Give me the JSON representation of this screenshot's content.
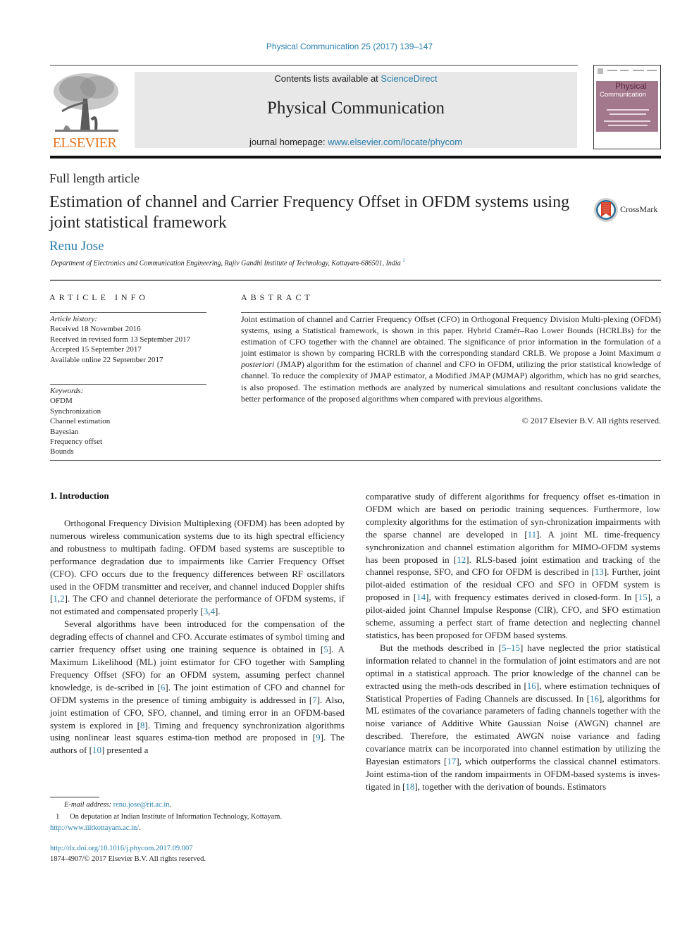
{
  "journal_reference": "Physical Communication 25 (2017) 139–147",
  "masthead": {
    "contents_prefix": "Contents lists available at ",
    "contents_link": "ScienceDirect",
    "journal_title": "Physical Communication",
    "homepage_prefix": "journal homepage: ",
    "homepage_link": "www.elsevier.com/locate/phycom",
    "publisher_logo_text": "ELSEVIER",
    "cover": {
      "title_line1": "Physical",
      "title_line2": "Communication"
    }
  },
  "colors": {
    "link": "#2a7fab",
    "elsevier_orange": "#e87722",
    "masthead_bg": "#e8e8e8",
    "cover_band": "#a4788c"
  },
  "article": {
    "type": "Full length article",
    "title": "Estimation of channel and Carrier Frequency Offset in OFDM systems using joint statistical framework",
    "crossmark_label": "CrossMark",
    "author": "Renu Jose",
    "affiliation": "Department of Electronics and Communication Engineering, Rajiv Gandhi Institute of Technology, Kottayam-686501, India",
    "affiliation_footnote_mark": "1"
  },
  "article_info": {
    "heading": "ARTICLE INFO",
    "history_label": "Article history:",
    "history": [
      "Received 18 November 2016",
      "Received in revised form 13 September 2017",
      "Accepted 15 September 2017",
      "Available online 22 September 2017"
    ],
    "keywords_label": "Keywords:",
    "keywords": [
      "OFDM",
      "Synchronization",
      "Channel estimation",
      "Bayesian",
      "Frequency offset",
      "Bounds"
    ]
  },
  "abstract": {
    "heading": "ABSTRACT",
    "text_part1": "Joint estimation of channel and Carrier Frequency Offset (CFO) in Orthogonal Frequency Division Multi-plexing (OFDM) systems, using a Statistical framework, is shown in this paper. Hybrid Cramér–Rao Lower Bounds (HCRLBs) for the estimation of CFO together with the channel are obtained. The significance of prior information in the formulation of a joint estimator is shown by comparing HCRLB with the corresponding standard CRLB. We propose a Joint Maximum ",
    "text_italic": "a posteriori",
    "text_part2": " (JMAP) algorithm for the estimation of channel and CFO in OFDM, utilizing the prior statistical knowledge of channel. To reduce the complexity of JMAP estimator, a Modified JMAP (MJMAP) algorithm, which has no grid searches, is also proposed. The estimation methods are analyzed by numerical simulations and resultant conclusions validate the better performance of the proposed algorithms when compared with previous algorithms.",
    "copyright": "© 2017 Elsevier B.V. All rights reserved."
  },
  "introduction": {
    "heading": "1.  Introduction",
    "p1": [
      {
        "t": "Orthogonal Frequency Division Multiplexing (OFDM) has been adopted by numerous wireless communication systems due to its high spectral efficiency and robustness to multipath fading. OFDM based systems are susceptible to performance degradation due to impairments like Carrier Frequency Offset (CFO). CFO occurs due to the frequency differences between RF oscillators used in the OFDM transmitter and receiver, and channel induced Doppler shifts ["
      },
      {
        "ref": "1"
      },
      {
        "t": ","
      },
      {
        "ref": "2"
      },
      {
        "t": "]. The CFO and channel deteriorate the performance of OFDM systems, if not estimated and compensated properly ["
      },
      {
        "ref": "3"
      },
      {
        "t": ","
      },
      {
        "ref": "4"
      },
      {
        "t": "]."
      }
    ],
    "p2": [
      {
        "t": "Several algorithms have been introduced for the compensation of the degrading effects of channel and CFO. Accurate estimates of symbol timing and carrier frequency offset using one training sequence is obtained in ["
      },
      {
        "ref": "5"
      },
      {
        "t": "]. A Maximum Likelihood (ML) joint estimator for CFO together with Sampling Frequency Offset (SFO) for an OFDM system, assuming perfect channel knowledge, is de-scribed in ["
      },
      {
        "ref": "6"
      },
      {
        "t": "]. The joint estimation of CFO and channel for OFDM systems in the presence of timing ambiguity is addressed in ["
      },
      {
        "ref": "7"
      },
      {
        "t": "]. Also, joint estimation of CFO, SFO, channel, and timing error in an OFDM-based system is explored in ["
      },
      {
        "ref": "8"
      },
      {
        "t": "]. Timing and frequency synchronization algorithms using nonlinear least squares estima-tion method are proposed in ["
      },
      {
        "ref": "9"
      },
      {
        "t": "]. The authors of ["
      },
      {
        "ref": "10"
      },
      {
        "t": "] presented a comparative study of different algorithms for frequency offset es-timation in OFDM which are based on periodic training sequences. Furthermore, low complexity algorithms for the estimation of syn-chronization impairments with the sparse channel are developed in ["
      },
      {
        "ref": "11"
      },
      {
        "t": "]. A joint ML time-frequency synchronization and channel estimation algorithm for MIMO-OFDM systems has been proposed in ["
      },
      {
        "ref": "12"
      },
      {
        "t": "]. RLS-based joint estimation and tracking of the channel response, SFO, and CFO for OFDM is described in ["
      },
      {
        "ref": "13"
      },
      {
        "t": "]. Further, joint pilot-aided estimation of the residual CFO and SFO in OFDM system is proposed in ["
      },
      {
        "ref": "14"
      },
      {
        "t": "], with frequency estimates derived in closed-form. In ["
      },
      {
        "ref": "15"
      },
      {
        "t": "], a pilot-aided joint Channel Impulse Response (CIR), CFO, and SFO estimation scheme, assuming a perfect start of frame detection and neglecting channel statistics, has been proposed for OFDM based systems."
      }
    ],
    "p3": [
      {
        "t": "But the methods described in ["
      },
      {
        "ref": "5–15"
      },
      {
        "t": "] have neglected the prior statistical information related to channel in the formulation of joint estimators and are not optimal in a statistical approach. The prior knowledge of the channel can be extracted using the meth-ods described in ["
      },
      {
        "ref": "16"
      },
      {
        "t": "], where estimation techniques of Statistical Properties of Fading Channels are discussed. In ["
      },
      {
        "ref": "16"
      },
      {
        "t": "], algorithms for ML estimates of the covariance parameters of fading channels together with the noise variance of Additive White Gaussian Noise (AWGN) channel are described. Therefore, the estimated AWGN noise variance and fading covariance matrix can be incorporated into channel estimation by utilizing the Bayesian estimators ["
      },
      {
        "ref": "17"
      },
      {
        "t": "], which outperforms the classical channel estimators. Joint estima-tion of the random impairments in OFDM-based systems is inves-tigated in ["
      },
      {
        "ref": "18"
      },
      {
        "t": "], together with the derivation of bounds. Estimators"
      }
    ]
  },
  "footnotes": {
    "email_label": "E-mail address:",
    "email": "renu.jose@rit.ac.in",
    "note_number": "1",
    "note_text": "On deputation at Indian Institute of Information Technology, Kottayam.",
    "note_link": "http://www.iiitkottayam.ac.in/",
    "doi": "http://dx.doi.org/10.1016/j.phycom.2017.09.007",
    "issn_copyright": "1874-4907/© 2017 Elsevier B.V. All rights reserved."
  }
}
